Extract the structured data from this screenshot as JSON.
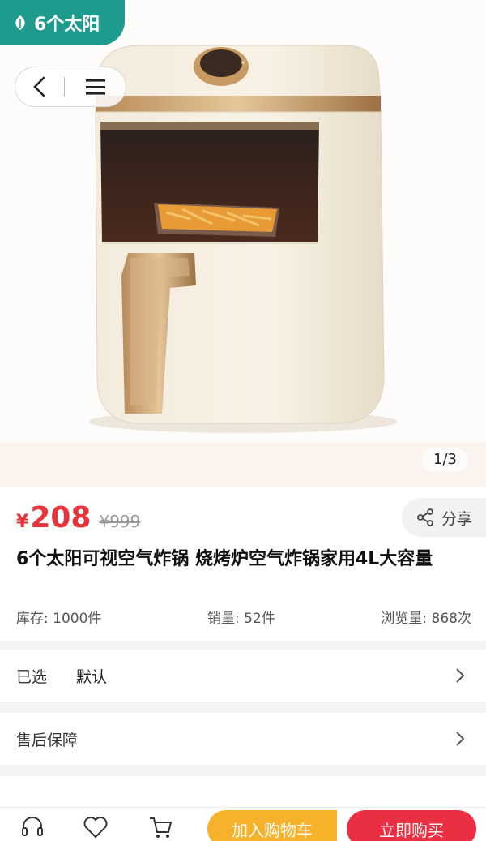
{
  "brand": {
    "name": "6个太阳"
  },
  "hero": {
    "page_indicator": "1/3"
  },
  "product": {
    "currency": "¥",
    "price": "208",
    "original_price": "¥999",
    "title": "6个太阳可视空气炸锅 烧烤炉空气炸锅家用4L大容量",
    "share_label": "分享"
  },
  "stats": {
    "stock": "库存: 1000件",
    "sales": "销量: 52件",
    "views": "浏览量: 868次"
  },
  "options": {
    "selected_label": "已选",
    "selected_value": "默认",
    "aftersale_label": "售后保障"
  },
  "actions": {
    "add_to_cart": "加入购物车",
    "buy_now": "立即购买"
  },
  "colors": {
    "brand": "#1f9b8d",
    "price": "#e8333a",
    "cart_button": "#f7b22b",
    "buy_button": "#ea2f42"
  }
}
